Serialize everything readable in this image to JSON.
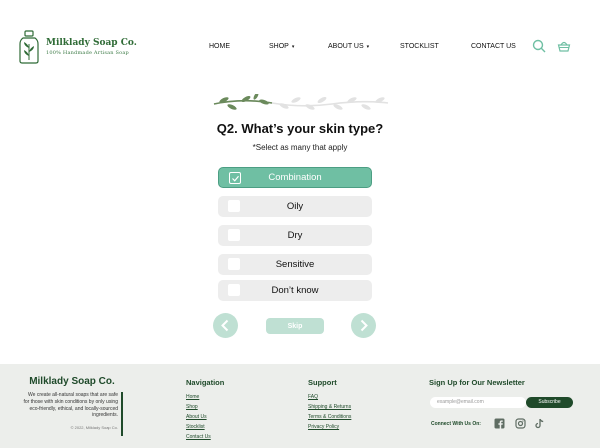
{
  "brand": {
    "name": "Milklady Soap Co.",
    "tagline": "100% Handmade Artisan Soap"
  },
  "nav": {
    "home": "HOME",
    "shop": "SHOP",
    "about": "ABOUT US",
    "stockist": "STOCKLIST",
    "contact": "CONTACT US"
  },
  "quiz": {
    "title": "Q2. What’s your skin type?",
    "hint": "*Select as many that apply",
    "options": [
      {
        "label": "Combination",
        "selected": true
      },
      {
        "label": "Oily",
        "selected": false
      },
      {
        "label": "Dry",
        "selected": false
      },
      {
        "label": "Sensitive",
        "selected": false
      },
      {
        "label": "Don’t know",
        "selected": false
      }
    ],
    "skip": "Skip"
  },
  "footer": {
    "brand": "Milklady Soap Co.",
    "description": "We create all-natural soaps that are safe for those with skin conditions by only using eco-friendly, ethical, and locally-sourced ingredients.",
    "copyright": "© 2022, Milklady Soap Co.",
    "navigation": {
      "heading": "Navigation",
      "links": [
        "Home",
        "Shop",
        "About Us",
        "Stocklist",
        "Contact Us"
      ]
    },
    "support": {
      "heading": "Support",
      "links": [
        "FAQ",
        "Shipping & Returns",
        "Terms & Conditions",
        "Privacy Policy"
      ]
    },
    "newsletter": {
      "heading": "Sign Up for Our Newsletter",
      "placeholder": "example@email.com",
      "button": "Subscribe",
      "connect": "Connect With Us On:"
    }
  },
  "colors": {
    "brand_green": "#2f6b36",
    "accent_mint": "#6fbfa3",
    "disabled_mint": "#bfe0d3",
    "footer_bg": "#eceeeb",
    "footer_dark": "#1f4a2a"
  },
  "icons": [
    "search-icon",
    "basket-icon",
    "chevron-left-icon",
    "chevron-right-icon",
    "facebook-icon",
    "instagram-icon",
    "tiktok-icon",
    "check-icon"
  ]
}
